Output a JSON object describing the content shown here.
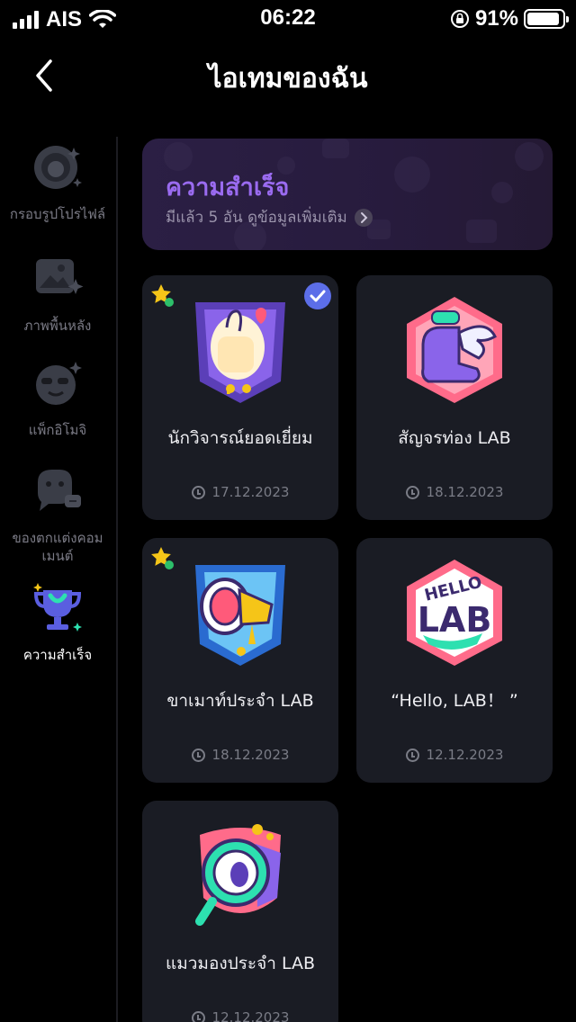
{
  "status_bar": {
    "carrier": "AIS",
    "time": "06:22",
    "battery_percent": "91%",
    "battery_level": 0.91
  },
  "header": {
    "title": "ไอเทมของฉัน"
  },
  "sidebar": {
    "items": [
      {
        "label": "กรอบรูปโปรไฟล์",
        "icon": "profile-frame-icon"
      },
      {
        "label": "ภาพพื้นหลัง",
        "icon": "background-image-icon"
      },
      {
        "label": "แพ็กอิโมจิ",
        "icon": "emoji-pack-icon"
      },
      {
        "label": "ของตกแต่งคอม\nเมนต์",
        "icon": "comment-decoration-icon"
      },
      {
        "label": "ความสำเร็จ",
        "icon": "trophy-icon",
        "active": true
      }
    ]
  },
  "banner": {
    "title": "ความสำเร็จ",
    "subtitle": "มีแล้ว 5 อัน ดูข้อมูลเพิ่มเติม"
  },
  "achievements": [
    {
      "name": "นักวิจารณ์ยอดเยี่ยม",
      "date": "17.12.2023",
      "icon": "thumbs-up-badge-icon",
      "starred": true,
      "equipped": true
    },
    {
      "name": "สัญจรท่อง LAB",
      "date": "18.12.2023",
      "icon": "winged-boot-badge-icon",
      "starred": false,
      "equipped": false
    },
    {
      "name": "ขาเมาท์ประจำ LAB",
      "date": "18.12.2023",
      "icon": "megaphone-badge-icon",
      "starred": true,
      "equipped": false
    },
    {
      "name": "“Hello, LAB！ ”",
      "date": "12.12.2023",
      "icon": "hello-lab-badge-icon",
      "starred": false,
      "equipped": false
    },
    {
      "name": "แมวมองประจำ LAB",
      "date": "12.12.2023",
      "icon": "magnifier-badge-icon",
      "starred": false,
      "equipped": false
    }
  ],
  "colors": {
    "background": "#000000",
    "card": "#1a1c24",
    "accent_purple": "#9a6bf0",
    "check_blue": "#5c6ee8"
  }
}
